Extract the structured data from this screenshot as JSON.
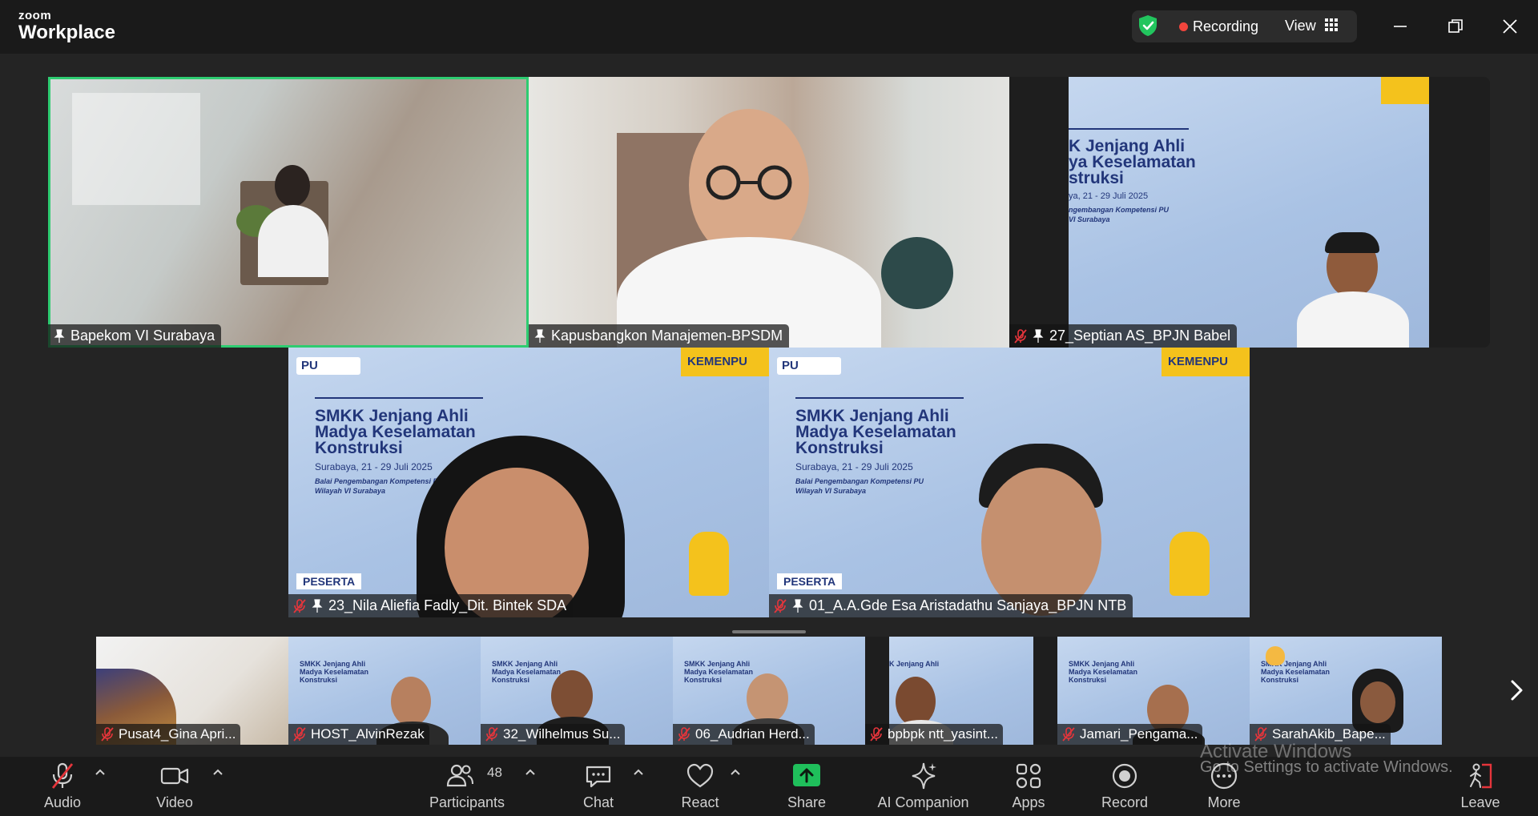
{
  "app": {
    "brand_top": "zoom",
    "brand_bottom": "Workplace"
  },
  "titlebar": {
    "recording_label": "Recording",
    "view_label": "View"
  },
  "gallery": {
    "tiles": [
      {
        "name": "Bapekom VI Surabaya",
        "muted": false,
        "active": true
      },
      {
        "name": "Kapusbangkon Manajemen-BPSDM",
        "muted": false,
        "active": false
      },
      {
        "name": "27_Septian AS_BPJN Babel",
        "muted": true,
        "active": false
      },
      {
        "name": "23_Nila Aliefia Fadly_Dit. Bintek SDA",
        "muted": true,
        "active": false
      },
      {
        "name": "01_A.A.Gde Esa Aristadathu Sanjaya_BPJN NTB",
        "muted": true,
        "active": false
      }
    ]
  },
  "slide": {
    "title_line1": "SMKK Jenjang Ahli",
    "title_line2": "Madya Keselamatan",
    "title_line3": "Konstruksi",
    "date": "Surabaya, 21 - 29 Juli 2025",
    "org_line1": "Balai Pengembangan Kompetensi PU",
    "org_line2": "Wilayah VI Surabaya",
    "partial_title_line1": "K Jenjang Ahli",
    "partial_title_line2": "ya Keselamatan",
    "partial_title_line3": "struksi",
    "partial_date": "ya, 21 - 29 Juli 2025",
    "partial_org_line1": "ngembangan Kompetensi PU",
    "partial_org_line2": "VI Surabaya",
    "peserta": "PESERTA",
    "pu_logo": "PU",
    "kemenpu_logo": "KEMENPU"
  },
  "strip": {
    "tiles": [
      {
        "name": "Pusat4_Gina Apri..."
      },
      {
        "name": "HOST_AlvinRezak"
      },
      {
        "name": "32_Wilhelmus Su..."
      },
      {
        "name": "06_Audrian Herd..."
      },
      {
        "name": "bpbpk ntt_yasint..."
      },
      {
        "name": "Jamari_Pengama..."
      },
      {
        "name": "SarahAkib_Bape..."
      }
    ]
  },
  "toolbar": {
    "audio": "Audio",
    "video": "Video",
    "participants": "Participants",
    "participants_count": "48",
    "chat": "Chat",
    "react": "React",
    "share": "Share",
    "ai_companion": "AI Companion",
    "apps": "Apps",
    "record": "Record",
    "more": "More",
    "leave": "Leave"
  },
  "watermark": {
    "line1": "Activate Windows",
    "line2": "Go to Settings to activate Windows."
  },
  "colors": {
    "active_speaker": "#2ecc71",
    "recording_dot": "#f2453d",
    "shield": "#22c55e",
    "share": "#1fbf5b",
    "leave": "#e5353b"
  }
}
